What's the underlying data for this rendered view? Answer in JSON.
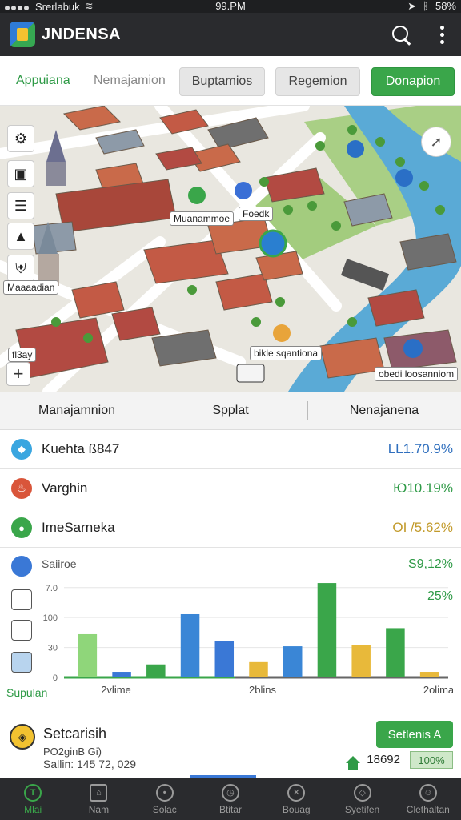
{
  "status_bar": {
    "carrier": "Srerlabuk",
    "time": "99.PM",
    "battery": "58%"
  },
  "app": {
    "title": "JNDENSA"
  },
  "tabs": {
    "active": "Appuiana",
    "plain": "Nemajamion",
    "buttons": [
      "Buptamios",
      "Regemion",
      "Donapion"
    ]
  },
  "map": {
    "labels": {
      "marker_a": "Muanammoe",
      "marker_b": "Foedk",
      "left_tag": "Maaaadian",
      "station": "bikle sqantiona",
      "bottom_right": "obedi loosanniom",
      "left_small": "fl3ay"
    }
  },
  "segments": [
    "Manajamnion",
    "Spplat",
    "Nenajanena"
  ],
  "stats": [
    {
      "label": "Kuehta ß847",
      "value": "LL1.70.9%",
      "color": "#2f6fbe",
      "icon_color": "#3aa6e0"
    },
    {
      "label": "Varghin",
      "value": "Ю10.19%",
      "color": "#2e9a46",
      "icon_color": "#d9553a"
    },
    {
      "label": "ImeSarneka",
      "value": "OI /5.62%",
      "color": "#c29a2a",
      "icon_color": "#3aa64a"
    }
  ],
  "chart_panel": {
    "title": "Saiiroe",
    "value": "S9,12%",
    "sub_value": "25%",
    "footer_label": "Supulan",
    "side_icons": [
      "share-icon",
      "pen-icon",
      "document-icon",
      "box-icon"
    ]
  },
  "chart_data": {
    "type": "bar",
    "ytick_labels": [
      "0",
      "30",
      "100",
      "7.0"
    ],
    "xtick_labels": [
      "2vlime",
      "2blins",
      "2olima"
    ],
    "values": [
      93,
      12,
      28,
      136,
      78,
      33,
      67,
      203,
      69,
      106,
      12
    ],
    "bar_colors": [
      "#8fd67a",
      "#3a78d6",
      "#3aa64a",
      "#3a86d6",
      "#3a78d6",
      "#e8b93a",
      "#3a86d6",
      "#3aa64a",
      "#e8b93a",
      "#3aa64a",
      "#e8b93a"
    ],
    "ylim": [
      0,
      210
    ]
  },
  "info": {
    "title": "Setcarisih",
    "line1": "PO2ginB Gi)",
    "line2": "Sallin: 145 72, 029",
    "button": "Setlenis A",
    "count": "18692",
    "pct": "100%"
  },
  "bottom_nav": [
    "Mlai",
    "Nam",
    "Solac",
    "Btitar",
    "Bouag",
    "Syetifen",
    "Clethaltan"
  ]
}
